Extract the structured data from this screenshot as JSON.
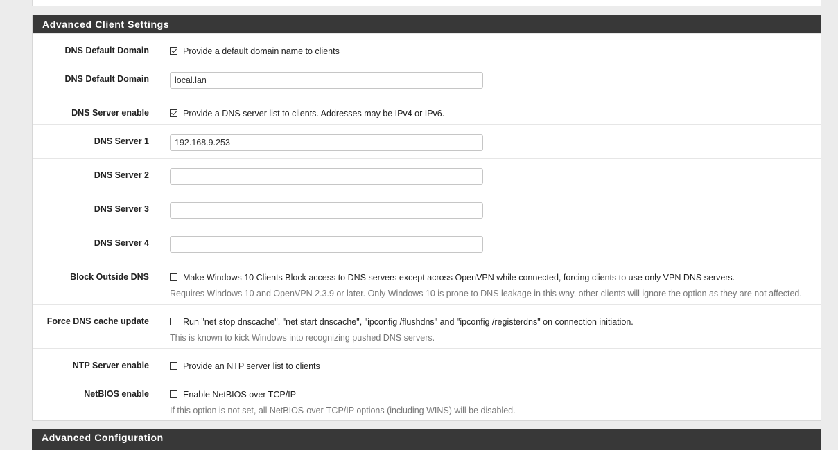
{
  "section": {
    "title": "Advanced Client Settings"
  },
  "rows": {
    "dns_default_domain_enable": {
      "label": "DNS Default Domain",
      "checked": true,
      "text": "Provide a default domain name to clients"
    },
    "dns_default_domain": {
      "label": "DNS Default Domain",
      "value": "local.lan"
    },
    "dns_server_enable": {
      "label": "DNS Server enable",
      "checked": true,
      "text": "Provide a DNS server list to clients. Addresses may be IPv4 or IPv6."
    },
    "dns_server1": {
      "label": "DNS Server 1",
      "value": "192.168.9.253"
    },
    "dns_server2": {
      "label": "DNS Server 2",
      "value": ""
    },
    "dns_server3": {
      "label": "DNS Server 3",
      "value": ""
    },
    "dns_server4": {
      "label": "DNS Server 4",
      "value": ""
    },
    "block_outside_dns": {
      "label": "Block Outside DNS",
      "checked": false,
      "text": "Make Windows 10 Clients Block access to DNS servers except across OpenVPN while connected, forcing clients to use only VPN DNS servers.",
      "help": "Requires Windows 10 and OpenVPN 2.3.9 or later. Only Windows 10 is prone to DNS leakage in this way, other clients will ignore the option as they are not affected."
    },
    "force_dns_cache_update": {
      "label": "Force DNS cache update",
      "checked": false,
      "text": "Run \"net stop dnscache\", \"net start dnscache\", \"ipconfig /flushdns\" and \"ipconfig /registerdns\" on connection initiation.",
      "help": "This is known to kick Windows into recognizing pushed DNS servers."
    },
    "ntp_server_enable": {
      "label": "NTP Server enable",
      "checked": false,
      "text": "Provide an NTP server list to clients"
    },
    "netbios_enable": {
      "label": "NetBIOS enable",
      "checked": false,
      "text": "Enable NetBIOS over TCP/IP",
      "help": "If this option is not set, all NetBIOS-over-TCP/IP options (including WINS) will be disabled."
    }
  },
  "next_section": {
    "title": "Advanced Configuration"
  }
}
